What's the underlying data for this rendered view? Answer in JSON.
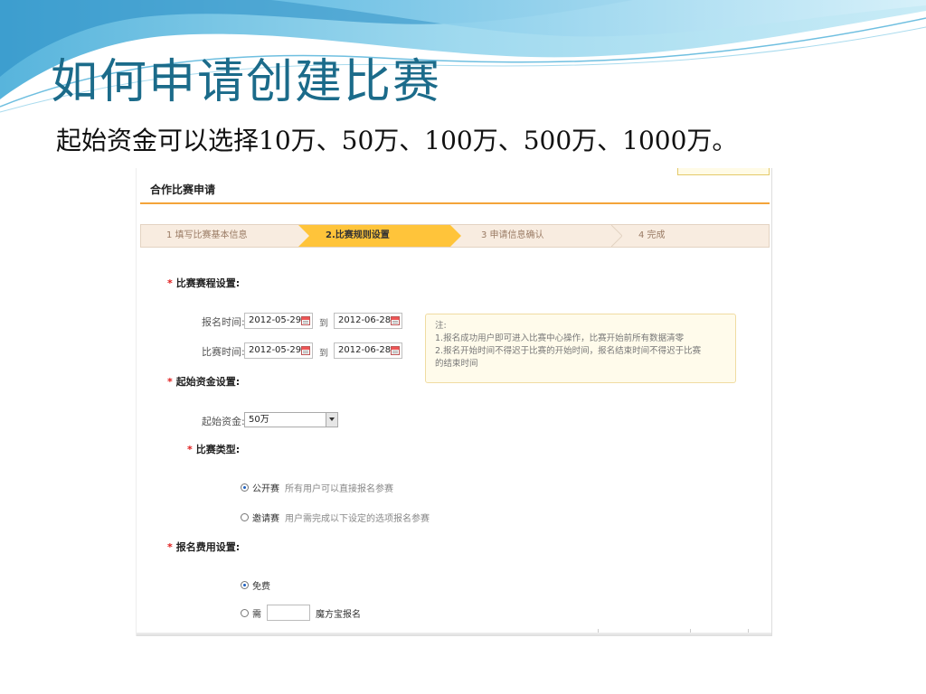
{
  "slide": {
    "title": "如何申请创建比赛",
    "subtitle": "起始资金可以选择10万、50万、100万、500万、1000万。"
  },
  "form": {
    "title": "合作比赛申请",
    "steps": [
      {
        "label": "1 填写比赛基本信息",
        "active": false
      },
      {
        "label": "2.比赛规则设置",
        "active": true
      },
      {
        "label": "3 申请信息确认",
        "active": false
      },
      {
        "label": "4 完成",
        "active": false
      }
    ],
    "schedule": {
      "section_label": "比赛赛程设置:",
      "signup_label": "报名时间:",
      "signup_start": "2012-05-29",
      "signup_end": "2012-06-28",
      "match_label": "比赛时间:",
      "match_start": "2012-05-29",
      "match_end": "2012-06-28",
      "to_label": "到"
    },
    "notice": {
      "title": "注:",
      "line1": "1.报名成功用户即可进入比赛中心操作，比赛开始前所有数据清零",
      "line2": "2.报名开始时间不得迟于比赛的开始时间，报名结束时间不得迟于比赛",
      "line3": "的结束时间"
    },
    "capital": {
      "section_label": "起始资金设置:",
      "field_label": "起始资金:",
      "selected": "50万"
    },
    "match_type": {
      "section_label": "比赛类型:",
      "options": [
        {
          "label": "公开赛",
          "desc": "所有用户可以直接报名参赛",
          "checked": true
        },
        {
          "label": "邀请赛",
          "desc": "用户需完成以下设定的选项报名参赛",
          "checked": false
        }
      ]
    },
    "fee": {
      "section_label": "报名费用设置:",
      "free_label": "免费",
      "need_label": "需",
      "unit_label": "魔方宝报名",
      "free_checked": true
    }
  },
  "colors": {
    "title": "#1b6b8a",
    "accent_orange": "#f4a43a",
    "active_step": "#ffc43a",
    "required_star": "#e01b1b"
  }
}
